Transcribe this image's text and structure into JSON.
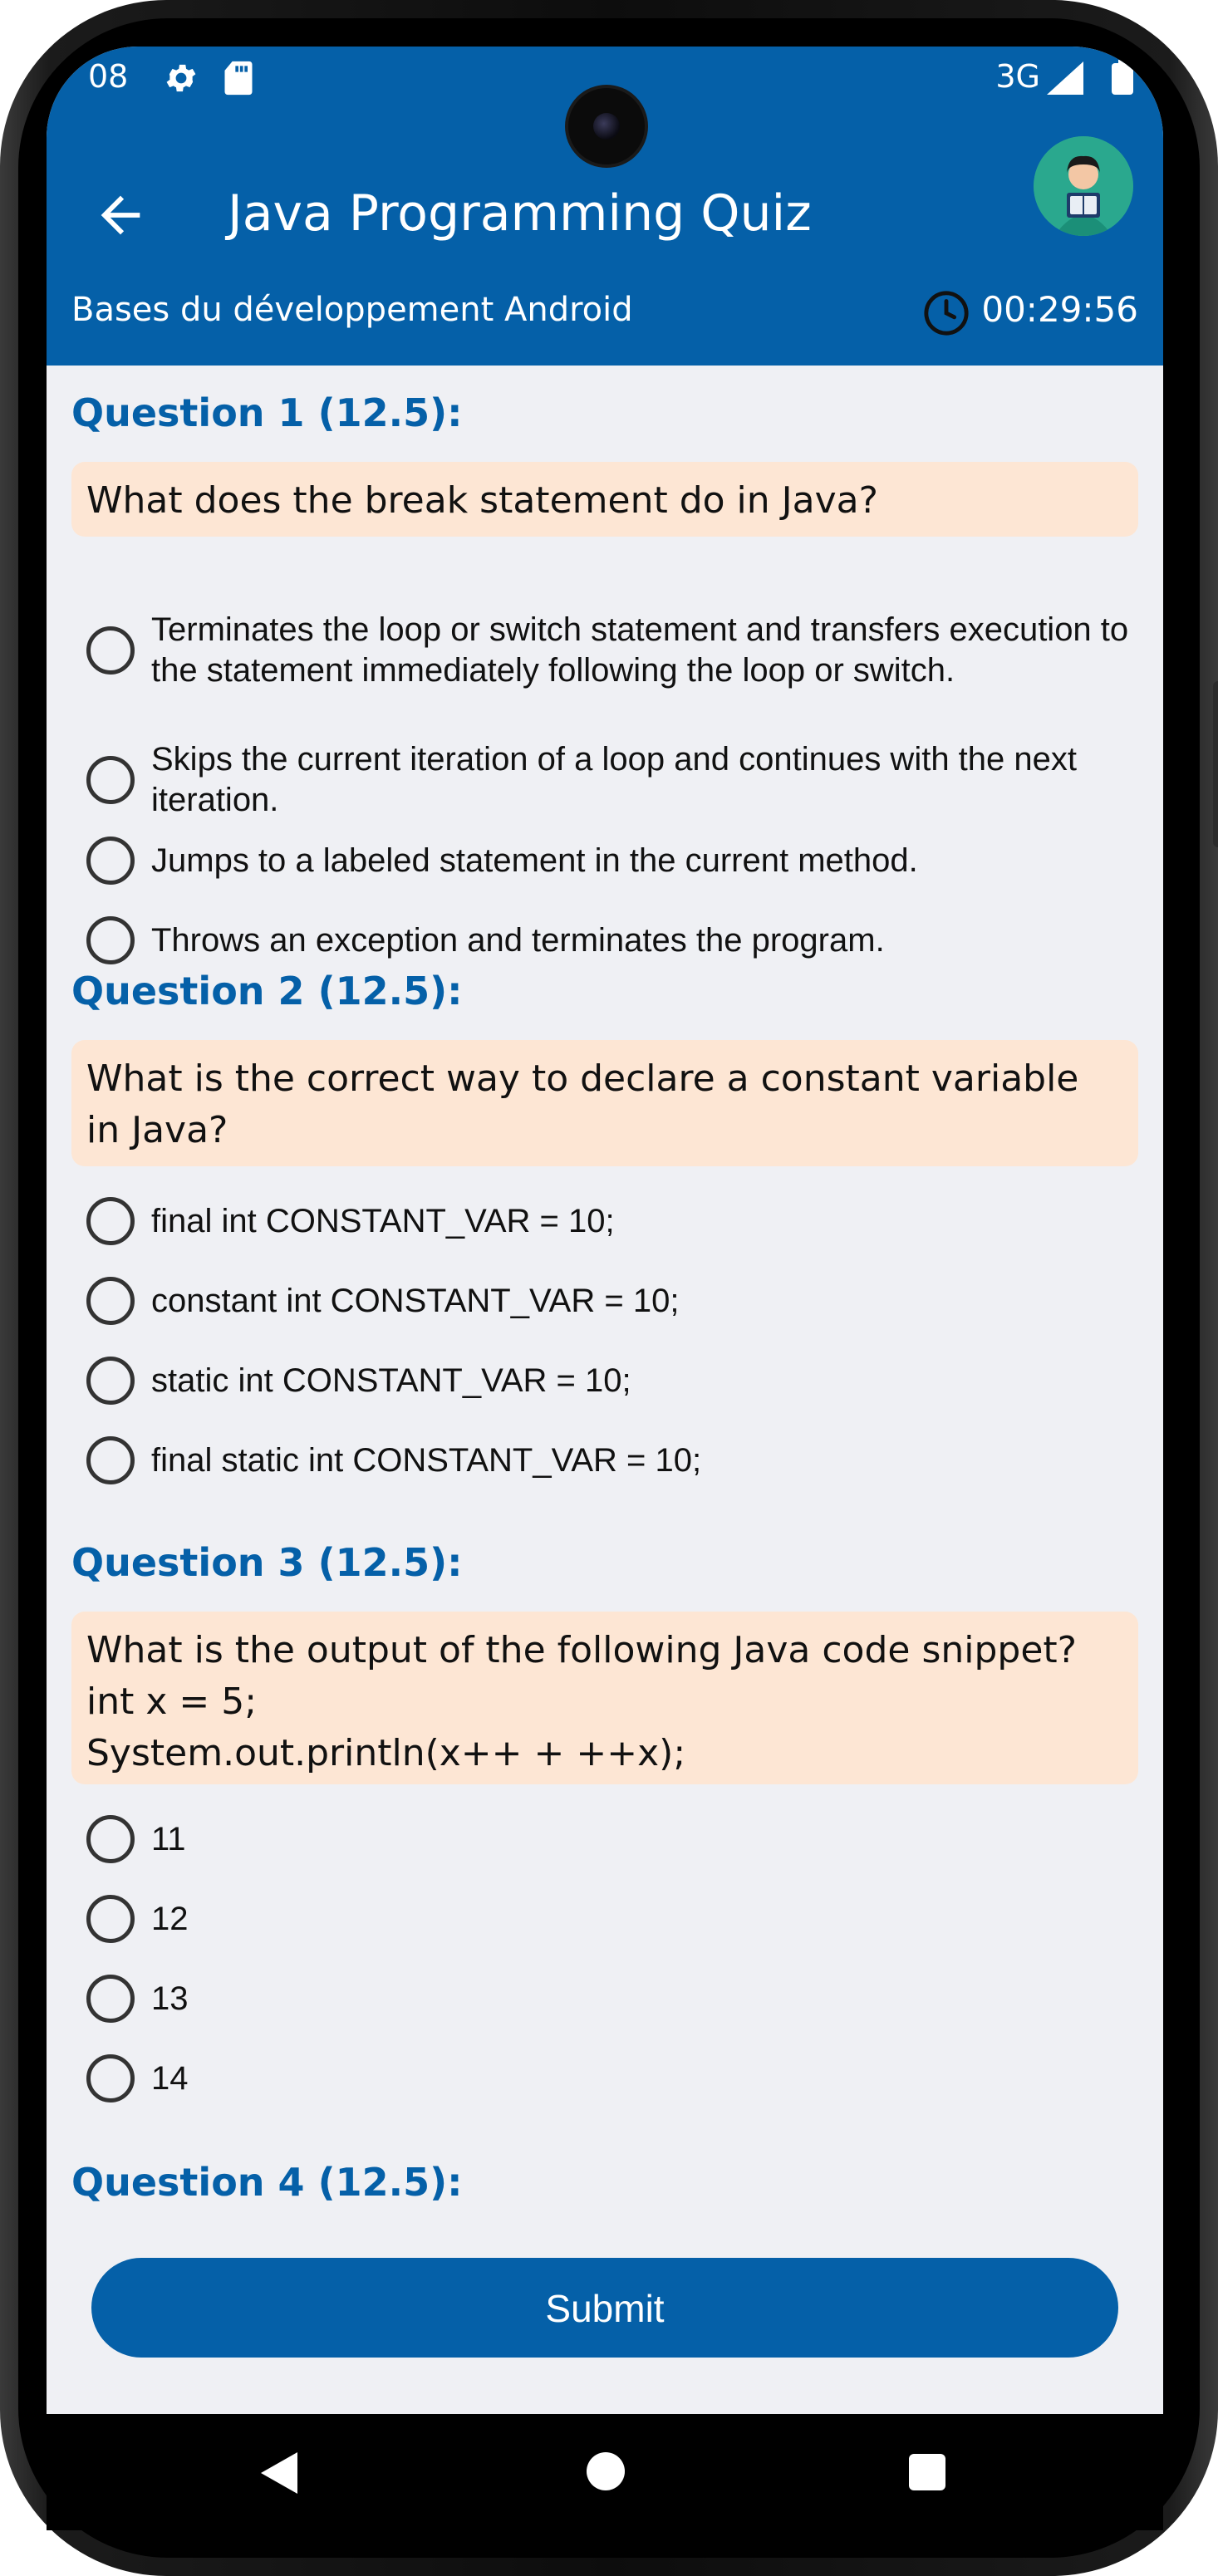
{
  "status_bar": {
    "time": "08",
    "network": "3G"
  },
  "app_bar": {
    "title": "Java Programming Quiz",
    "subtitle": "Bases du développement Android",
    "timer": "00:29:56"
  },
  "colors": {
    "primary": "#0560a8",
    "question_bg": "#fde6d4",
    "background": "#eff0f4"
  },
  "questions": [
    {
      "title": "Question 1 (12.5):",
      "text": "What does the break statement do in Java?",
      "options": [
        "Terminates the loop or switch statement and transfers execution to the statement immediately following the loop or switch.",
        "Skips the current iteration of a loop and continues with the next iteration.",
        "Jumps to a labeled statement in the current method.",
        "Throws an exception and terminates the program."
      ]
    },
    {
      "title": "Question 2 (12.5):",
      "text": "What is the correct way to declare a constant variable in Java?",
      "options": [
        "final int CONSTANT_VAR = 10;",
        "constant int CONSTANT_VAR = 10;",
        "static int CONSTANT_VAR = 10;",
        "final static int CONSTANT_VAR = 10;"
      ]
    },
    {
      "title": "Question 3 (12.5):",
      "text_lines": [
        "What is the output of the following Java code snippet?",
        "int x = 5;",
        "System.out.println(x++ + ++x);"
      ],
      "options": [
        "11",
        "12",
        "13",
        "14"
      ]
    },
    {
      "title": "Question 4 (12.5):"
    }
  ],
  "submit_label": "Submit"
}
